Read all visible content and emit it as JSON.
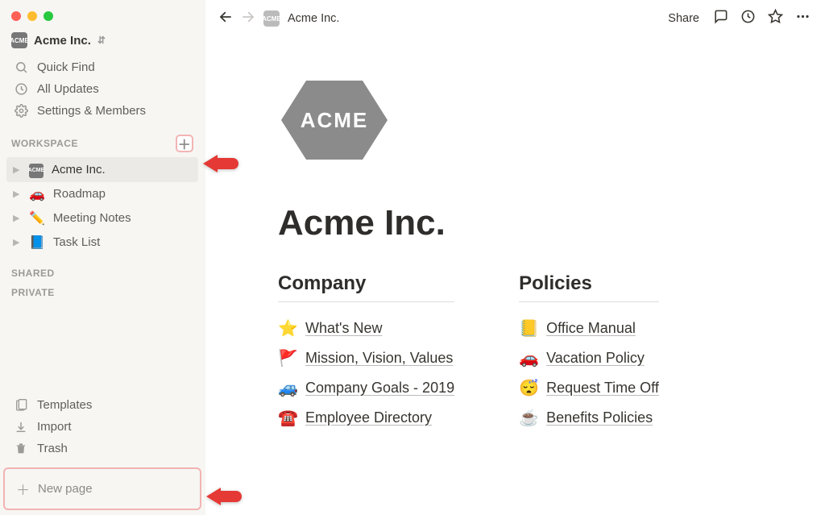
{
  "workspace": {
    "name": "Acme Inc.",
    "logo_text": "ACME"
  },
  "sidebar": {
    "quick_find": "Quick Find",
    "all_updates": "All Updates",
    "settings": "Settings & Members",
    "sections": {
      "workspace_label": "WORKSPACE",
      "shared_label": "SHARED",
      "private_label": "PRIVATE"
    },
    "pages": [
      {
        "emoji_name": "acme-logo",
        "emoji": "",
        "label": "Acme Inc.",
        "selected": true,
        "is_logo": true
      },
      {
        "emoji_name": "car-icon",
        "emoji": "🚗",
        "label": "Roadmap",
        "selected": false
      },
      {
        "emoji_name": "pencil-icon",
        "emoji": "✏️",
        "label": "Meeting Notes",
        "selected": false
      },
      {
        "emoji_name": "book-icon",
        "emoji": "📘",
        "label": "Task List",
        "selected": false
      }
    ],
    "templates": "Templates",
    "import": "Import",
    "trash": "Trash",
    "new_page": "New page"
  },
  "topbar": {
    "breadcrumb": "Acme Inc.",
    "share": "Share"
  },
  "page": {
    "title": "Acme Inc.",
    "logo_text": "ACME",
    "columns": [
      {
        "heading": "Company",
        "links": [
          {
            "emoji": "⭐",
            "emoji_name": "star-icon",
            "text": "What's New"
          },
          {
            "emoji": "🚩",
            "emoji_name": "flag-icon",
            "text": "Mission, Vision, Values"
          },
          {
            "emoji": "🚙",
            "emoji_name": "suv-icon",
            "text": "Company Goals - 2019"
          },
          {
            "emoji": "☎️",
            "emoji_name": "telephone-icon",
            "text": "Employee Directory"
          }
        ]
      },
      {
        "heading": "Policies",
        "links": [
          {
            "emoji": "📒",
            "emoji_name": "ledger-icon",
            "text": "Office Manual"
          },
          {
            "emoji": "🚗",
            "emoji_name": "car-icon",
            "text": "Vacation Policy"
          },
          {
            "emoji": "😴",
            "emoji_name": "sleeping-icon",
            "text": "Request Time Off"
          },
          {
            "emoji": "☕",
            "emoji_name": "coffee-icon",
            "text": "Benefits Policies"
          }
        ]
      }
    ]
  }
}
